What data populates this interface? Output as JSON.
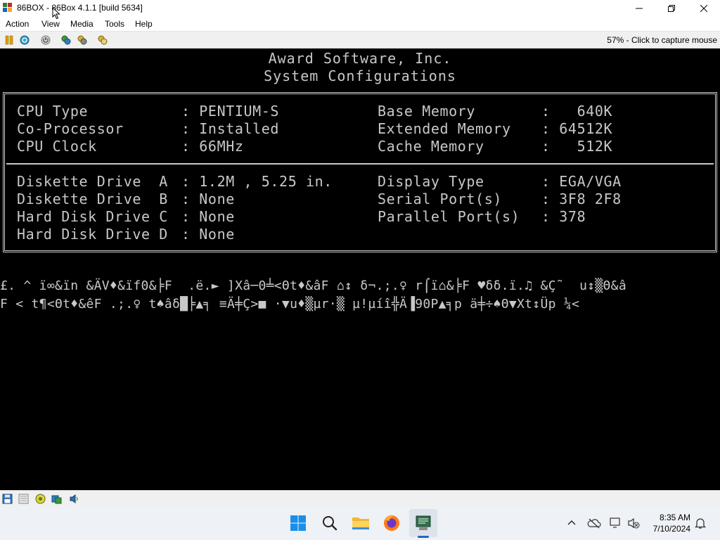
{
  "window": {
    "title": "86BOX - 86Box 4.1.1 [build 5634]"
  },
  "menu": {
    "items": [
      "Action",
      "View",
      "Media",
      "Tools",
      "Help"
    ]
  },
  "toolbar": {
    "capture_hint": "57% - Click to capture mouse",
    "icons": [
      "pause-icon",
      "ctrl-alt-del-icon",
      "power-icon",
      "settings-icon",
      "hard-reset-icon",
      "screenshot-icon"
    ]
  },
  "bios": {
    "header1": "Award Software, Inc.",
    "header2": "System Configurations",
    "rows_left_top": [
      [
        "CPU Type",
        ": PENTIUM-S"
      ],
      [
        "Co-Processor",
        ": Installed"
      ],
      [
        "CPU Clock",
        ": 66MHz"
      ]
    ],
    "rows_right_top": [
      [
        "Base Memory",
        ":   640K"
      ],
      [
        "Extended Memory",
        ": 64512K"
      ],
      [
        "Cache Memory",
        ":   512K"
      ]
    ],
    "rows_left_bottom": [
      [
        "Diskette Drive  A",
        ": 1.2M , 5.25 in."
      ],
      [
        "Diskette Drive  B",
        ": None"
      ],
      [
        "Hard Disk Drive C",
        ": None"
      ],
      [
        "Hard Disk Drive D",
        ": None"
      ]
    ],
    "rows_right_bottom": [
      [
        "Display Type",
        ": EGA/VGA"
      ],
      [
        "Serial Port(s)",
        ": 3F8 2F8"
      ],
      [
        "Parallel Port(s)",
        ": 378"
      ]
    ],
    "garbage_line1": "£. ^ ï∞&ïn &ÄV♦&ïf0&╞F  .ë.► ]Xâ─0╧<Θt♦&âF ⌂↕ δ¬.;.♀ r⌠ï⌂&╞F ♥δδ.ï.♫ &Ç˜  u↕▒Θ&â",
    "garbage_line2": "F < t¶<Θt♦&êF .;.♀ t♠âδ█╞▲╕ ≡Ä╪Ç>■ ·▼u♦▒µr·▒ µ!µíî╬Ä▐90P▲╕p ä╪÷♠Θ▼Xt↕Üp ¼<"
  },
  "statusbar": {
    "icons": [
      "floppy-icon",
      "cdrom-icon",
      "network-icon",
      "disk-activity-icon",
      "sound-icon"
    ]
  },
  "taskbar": {
    "apps": [
      "start-icon",
      "search-icon",
      "file-explorer-icon",
      "firefox-icon",
      "86box-taskbar-icon"
    ],
    "time": "8:35 AM",
    "date": "7/10/2024"
  }
}
